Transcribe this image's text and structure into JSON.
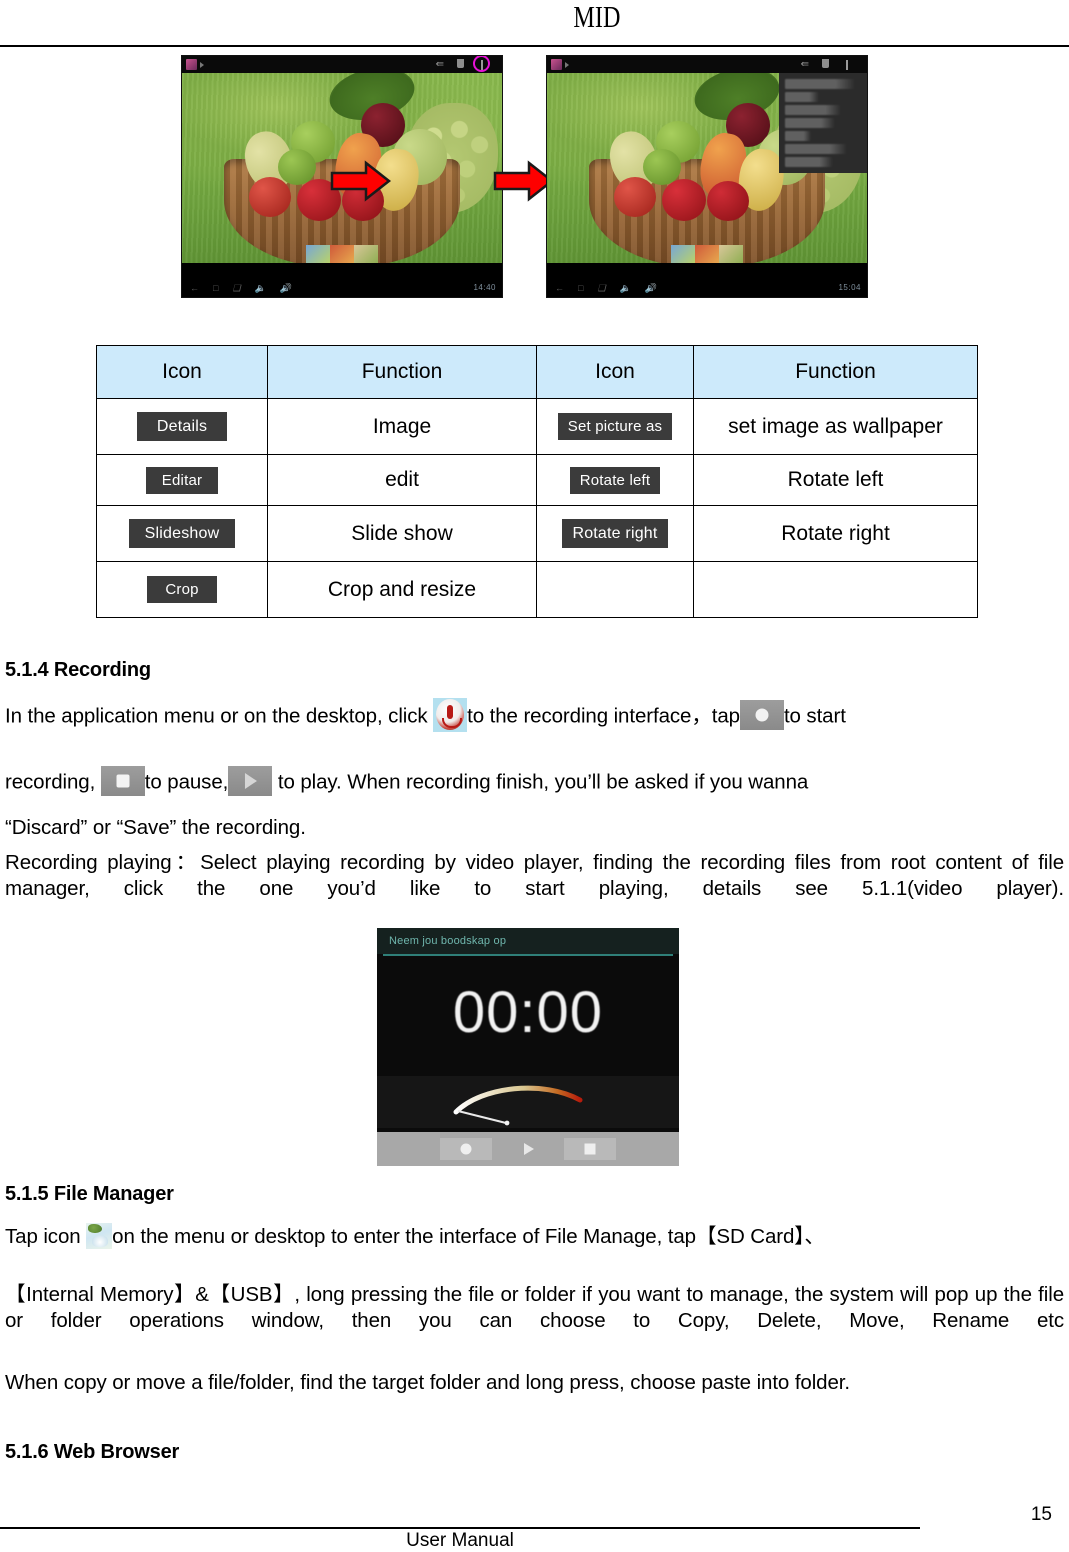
{
  "header": {
    "title": "MID"
  },
  "screenshots": {
    "left": {
      "name": "gallery-image-view",
      "status_icons": [
        "app-icon",
        "share-icon",
        "trash-icon",
        "overflow-menu-icon"
      ],
      "clock": "14:40",
      "highlight": "overflow-menu-highlight"
    },
    "right": {
      "name": "gallery-image-view-menu-open",
      "status_icons": [
        "app-icon",
        "share-icon",
        "trash-icon",
        "overflow-menu-icon"
      ],
      "clock": "15:04",
      "menu_items_count": 7
    },
    "arrow_label": "right-arrow"
  },
  "icon_table": {
    "headers": [
      "Icon",
      "Function",
      "Icon",
      "Function"
    ],
    "rows": [
      {
        "icon_a": "Details",
        "fn_a": "Image",
        "icon_b": "Set picture as",
        "fn_b": "set image as wallpaper"
      },
      {
        "icon_a": "Editar",
        "fn_a": "edit",
        "icon_b": "Rotate left",
        "fn_b": "Rotate left"
      },
      {
        "icon_a": "Slideshow",
        "fn_a": "Slide show",
        "icon_b": "Rotate right",
        "fn_b": "Rotate right"
      },
      {
        "icon_a": "Crop",
        "fn_a": "Crop and resize",
        "icon_b": "",
        "fn_b": ""
      }
    ]
  },
  "sections": {
    "recording": {
      "heading": "5.1.4 Recording",
      "line1_a": "In the application menu or on the desktop, click",
      "line1_b": "to the recording interface，tap",
      "line1_c": "to start",
      "line2_a": "recording,",
      "line2_b": "to pause,",
      "line2_c": "to play. When recording finish, you’ll be asked if you wanna",
      "line3": "“Discard” or “Save” the recording.",
      "line4": "Recording playing：Select playing recording by video player, finding the recording files from root content of file manager, click the one you’d like to start playing, details see 5.1.1(video player)."
    },
    "recorder_screenshot": {
      "title": "Neem jou boodskap op",
      "timer": "00:00",
      "buttons": [
        "record",
        "play",
        "stop"
      ]
    },
    "file_manager": {
      "heading": "5.1.5 File Manager",
      "line1_a": "Tap icon",
      "line1_b": "on the menu or desktop to enter the interface of File Manage, tap【SD Card】、",
      "line2": "【Internal Memory】&【USB】, long pressing the file or folder if you want to manage, the system will pop up the file or folder operations window, then you can choose to Copy, Delete, Move, Rename etc",
      "line3": "When copy or move a file/folder, find the target folder and long press, choose paste into folder."
    },
    "web_browser": {
      "heading": "5.1.6 Web Browser"
    }
  },
  "footer": {
    "label": "User Manual",
    "page_number": "15"
  }
}
